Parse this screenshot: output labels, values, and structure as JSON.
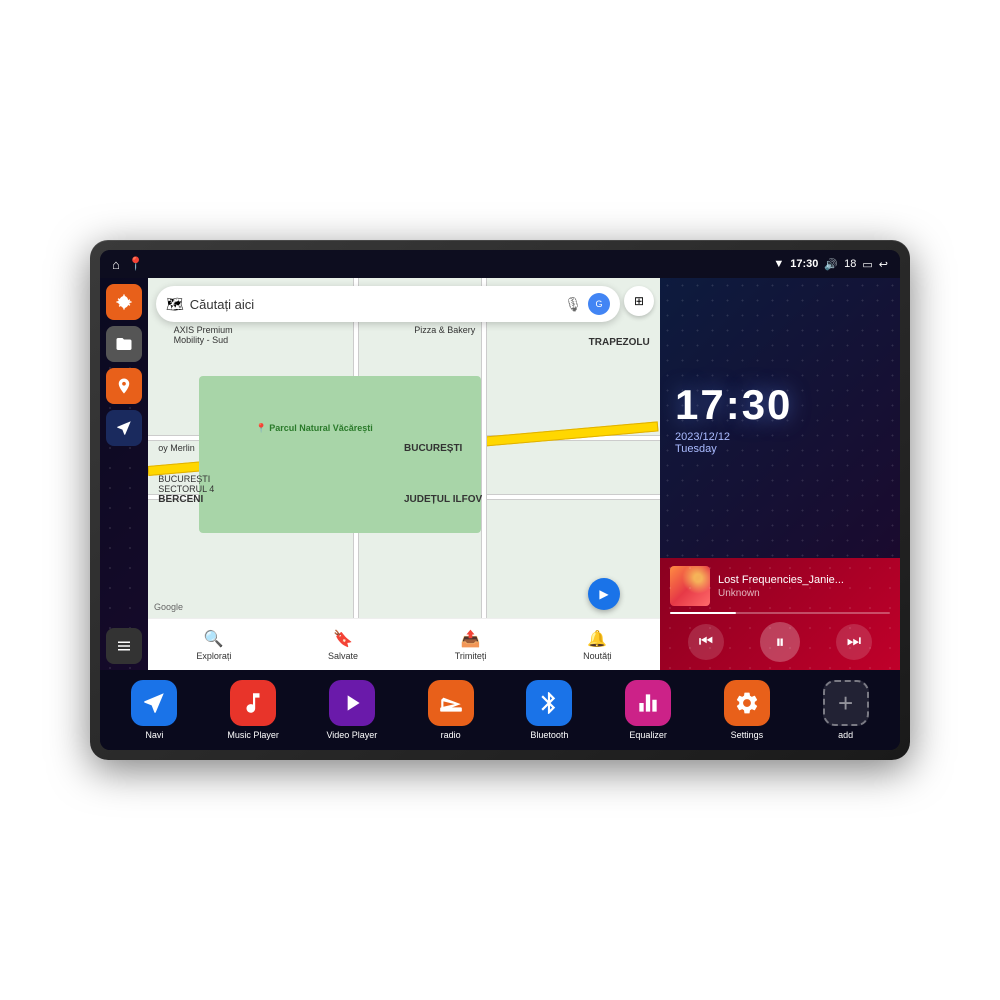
{
  "device": {
    "status_bar": {
      "left_icons": [
        "home",
        "location"
      ],
      "right": {
        "wifi": "▼",
        "time": "17:30",
        "volume": "🔊",
        "battery_level": "18",
        "battery_icon": "🔋",
        "back": "↩"
      }
    },
    "clock": {
      "time": "17:30",
      "date": "2023/12/12",
      "day": "Tuesday"
    },
    "music": {
      "title": "Lost Frequencies_Janie...",
      "artist": "Unknown",
      "progress": 30
    },
    "map": {
      "search_placeholder": "Căutați aici",
      "nav_items": [
        {
          "icon": "📍",
          "label": "Explorați"
        },
        {
          "icon": "🔖",
          "label": "Salvate"
        },
        {
          "icon": "📤",
          "label": "Trimiteți"
        },
        {
          "icon": "🔔",
          "label": "Noutăți"
        }
      ],
      "labels": [
        "AXIS Premium Mobility - Sud",
        "Pizza & Bakery",
        "TRAPEZOLU",
        "Parcul Natural Văcărești",
        "oy Merlin",
        "BUCUREȘTI SECTORUL 4",
        "BERCENI",
        "BUCUREȘTI",
        "JUDEȚUL ILFOV"
      ]
    },
    "sidebar": {
      "buttons": [
        {
          "id": "settings",
          "color": "orange",
          "icon": "⚙"
        },
        {
          "id": "files",
          "color": "gray",
          "icon": "🗂"
        },
        {
          "id": "map",
          "color": "orange",
          "icon": "📍"
        },
        {
          "id": "nav",
          "color": "blue",
          "icon": "▲"
        },
        {
          "id": "grid",
          "color": "bottom",
          "icon": "⋮⋮⋮"
        }
      ]
    },
    "apps": [
      {
        "id": "navi",
        "label": "Navi",
        "color": "navi",
        "icon": "▲"
      },
      {
        "id": "music-player",
        "label": "Music Player",
        "color": "music",
        "icon": "♪"
      },
      {
        "id": "video-player",
        "label": "Video Player",
        "color": "video",
        "icon": "▶"
      },
      {
        "id": "radio",
        "label": "radio",
        "color": "radio",
        "icon": "📻"
      },
      {
        "id": "bluetooth",
        "label": "Bluetooth",
        "color": "bluetooth",
        "icon": "⚡"
      },
      {
        "id": "equalizer",
        "label": "Equalizer",
        "color": "equalizer",
        "icon": "🎚"
      },
      {
        "id": "settings",
        "label": "Settings",
        "color": "settings",
        "icon": "⚙"
      },
      {
        "id": "add",
        "label": "add",
        "color": "add",
        "icon": "+"
      }
    ]
  }
}
